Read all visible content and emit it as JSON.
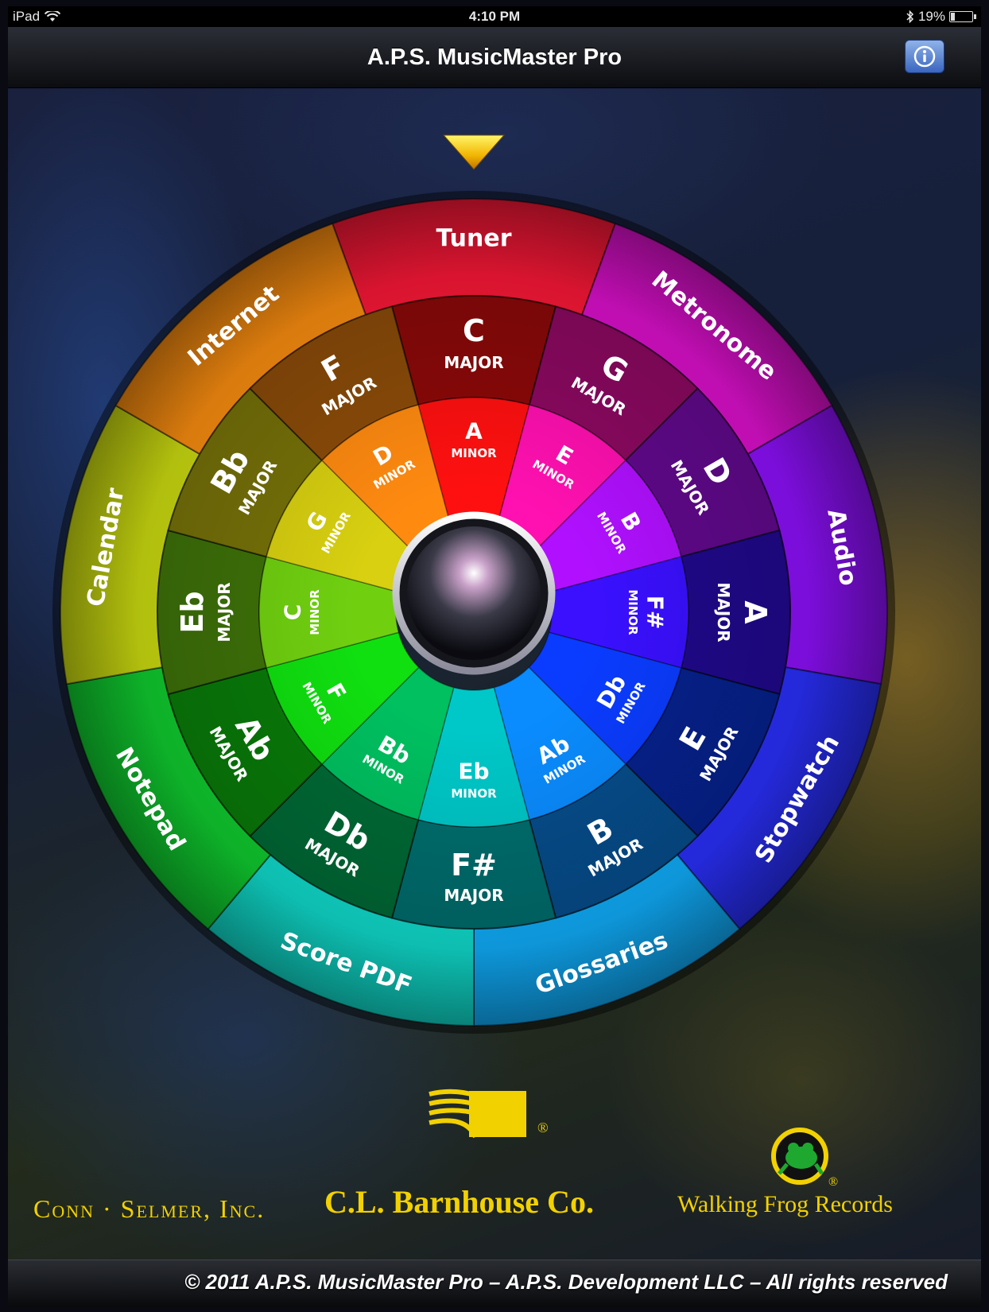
{
  "status_bar": {
    "device": "iPad",
    "time": "4:10 PM",
    "battery": "19%",
    "battery_level": 0.19,
    "icons": [
      "wifi-icon",
      "bluetooth-icon",
      "battery-icon"
    ]
  },
  "nav_bar": {
    "title": "A.P.S. MusicMaster Pro",
    "info_icon": "info-icon"
  },
  "wheel": {
    "pointer_icon": "triangle-down-pointer-icon",
    "tools": [
      "Tuner",
      "Metronome",
      "Audio",
      "Stopwatch",
      "Glossaries",
      "Score PDF",
      "Notepad",
      "Calendar",
      "Internet"
    ],
    "major_label": "MAJOR",
    "minor_label": "MINOR",
    "major_keys": [
      "C",
      "G",
      "D",
      "A",
      "E",
      "B",
      "F#",
      "Db",
      "Ab",
      "Eb",
      "Bb",
      "F"
    ],
    "minor_keys": [
      "A",
      "E",
      "B",
      "F#",
      "Db",
      "Ab",
      "Eb",
      "Bb",
      "F",
      "C",
      "G",
      "D"
    ],
    "key_colors": [
      "#ff1010",
      "#ff10b0",
      "#b010ff",
      "#3a10ff",
      "#0a3cff",
      "#0a8cff",
      "#00c8c8",
      "#00c060",
      "#10e010",
      "#70d010",
      "#d8d010",
      "#ff8a10"
    ],
    "tool_colors": [
      "#ff1838",
      "#e010d0",
      "#9010ff",
      "#2a30ff",
      "#10b0ff",
      "#10e0d0",
      "#10d030",
      "#d0e010",
      "#ff9010"
    ]
  },
  "sponsors": {
    "conn_selmer": "Conn · Selmer, Inc.",
    "barnhouse": "C.L. Barnhouse Co.",
    "barnhouse_mark": "®",
    "walking_frog": "Walking Frog Records",
    "frog_mark": "®",
    "logo_color": "#f2d100"
  },
  "footer": {
    "copyright": "© 2011 A.P.S. MusicMaster Pro – A.P.S. Development LLC – All rights reserved"
  }
}
